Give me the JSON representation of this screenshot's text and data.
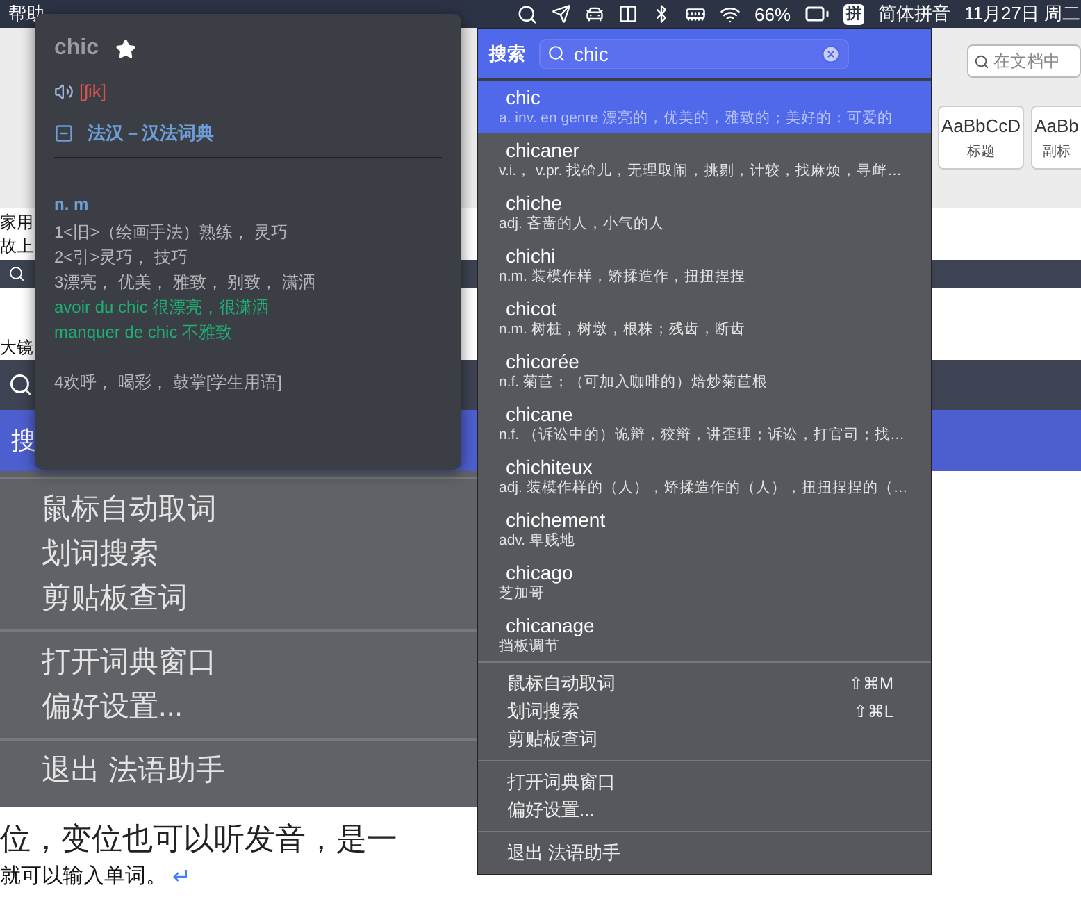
{
  "menu_bar": {
    "app_menu": "帮助",
    "battery": "66%",
    "input_badge": "拼",
    "input_method": "简体拼音",
    "datetime": "11月27日 周二"
  },
  "document": {
    "search_placeholder": "在文档中",
    "styles": [
      {
        "sample": "AaBbCcD",
        "name": "标题"
      },
      {
        "sample": "AaBb",
        "name": "副标"
      }
    ],
    "lines_top": [
      "家用",
      "故上"
    ],
    "fragment": "大镜",
    "strip_label": "搜",
    "embedded_menu": {
      "groups": [
        {
          "items": [
            "鼠标自动取词",
            "划词搜索",
            "剪贴板查词"
          ]
        },
        {
          "items": [
            "打开词典窗口",
            "偏好设置..."
          ]
        },
        {
          "items": [
            "退出 法语助手"
          ]
        }
      ]
    },
    "lines_bottom": [
      "位，变位也可以听发音，是一",
      "就可以输入单词。"
    ],
    "paragraph_mark": "↵"
  },
  "dictionary_panel": {
    "word": "chic",
    "starred": true,
    "phonetic": "[ʃik]",
    "dictionary": "法汉－汉法词典",
    "expanded": true,
    "part_of_speech": "n. m",
    "entries": [
      {
        "kind": "sense",
        "text": "1<旧>（绘画手法）熟练， 灵巧"
      },
      {
        "kind": "sense",
        "text": "2<引>灵巧， 技巧"
      },
      {
        "kind": "sense",
        "text": "3漂亮， 优美， 雅致， 别致， 潇洒"
      },
      {
        "kind": "example",
        "text": "avoir du chic 很漂亮，很潇洒"
      },
      {
        "kind": "example",
        "text": "manquer de chic 不雅致"
      },
      {
        "kind": "sense",
        "text": "4欢呼， 喝彩， 鼓掌[学生用语]"
      }
    ]
  },
  "search_menu": {
    "label": "搜索",
    "query": "chic",
    "results": [
      {
        "word": "chic",
        "definition": "a. inv. en genre 漂亮的，优美的，雅致的；美好的；可爱的",
        "selected": true
      },
      {
        "word": "chicaner",
        "definition": "v.i.， v.pr. 找碴儿，无理取闹，挑剔，计较，找麻烦，寻衅…",
        "selected": false
      },
      {
        "word": "chiche",
        "definition": "adj. 吝啬的人，小气的人",
        "selected": false
      },
      {
        "word": "chichi",
        "definition": "n.m. 装模作样，矫揉造作，扭扭捏捏",
        "selected": false
      },
      {
        "word": "chicot",
        "definition": "n.m. 树桩，树墩，根株；残齿，断齿",
        "selected": false
      },
      {
        "word": "chicorée",
        "definition": "n.f. 菊苣；（可加入咖啡的）焙炒菊苣根",
        "selected": false
      },
      {
        "word": "chicane",
        "definition": "n.f. （诉讼中的）诡辩，狡辩，讲歪理；诉讼，打官司；找…",
        "selected": false
      },
      {
        "word": "chichiteux",
        "definition": "adj. 装模作样的（人），矫揉造作的（人），扭扭捏捏的（…",
        "selected": false
      },
      {
        "word": "chichement",
        "definition": "adv. 卑贱地",
        "selected": false
      },
      {
        "word": "chicago",
        "definition": "芝加哥",
        "selected": false
      },
      {
        "word": "chicanage",
        "definition": "挡板调节",
        "selected": false
      }
    ],
    "groups": [
      {
        "items": [
          {
            "label": "鼠标自动取词",
            "shortcut": "⇧⌘M"
          },
          {
            "label": "划词搜索",
            "shortcut": "⇧⌘L"
          },
          {
            "label": "剪贴板查词"
          }
        ]
      },
      {
        "items": [
          {
            "label": "打开词典窗口"
          },
          {
            "label": "偏好设置..."
          }
        ]
      },
      {
        "items": [
          {
            "label": "退出 法语助手"
          }
        ]
      }
    ]
  }
}
